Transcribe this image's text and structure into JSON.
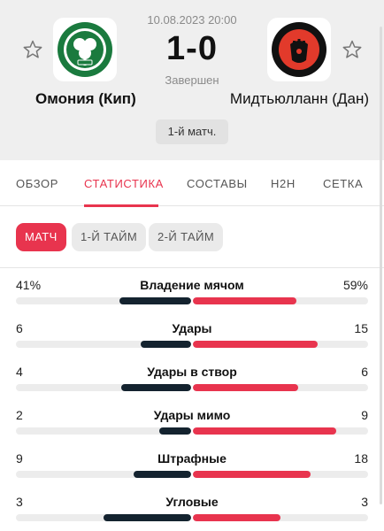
{
  "match": {
    "datetime": "10.08.2023 20:00",
    "score": "1-0",
    "status": "Завершен",
    "leg": "1-й матч.",
    "home": {
      "name": "Омония (Кип)",
      "logo_icon": "omonia-crest-icon",
      "color": "#1a7a3e"
    },
    "away": {
      "name": "Мидтьюлланн (Дан)",
      "logo_icon": "midtjylland-crest-icon",
      "color": "#e23a2b"
    }
  },
  "tabs": [
    {
      "label": "ОБЗОР"
    },
    {
      "label": "СТАТИСТИКА",
      "active": true
    },
    {
      "label": "СОСТАВЫ"
    },
    {
      "label": "H2H"
    },
    {
      "label": "СЕТКА"
    }
  ],
  "periods": [
    {
      "label": "МАТЧ",
      "active": true
    },
    {
      "label": "1-Й ТАЙМ"
    },
    {
      "label": "2-Й ТАЙМ"
    }
  ],
  "colors": {
    "accent": "#e8344e",
    "home_bar": "#14232f",
    "track": "#ececec"
  },
  "stats": [
    {
      "label": "Владение мячом",
      "home": "41%",
      "away": "59%",
      "home_share": 0.41,
      "away_share": 0.59
    },
    {
      "label": "Удары",
      "home": "6",
      "away": "15",
      "home_share": 0.29,
      "away_share": 0.71
    },
    {
      "label": "Удары в створ",
      "home": "4",
      "away": "6",
      "home_share": 0.4,
      "away_share": 0.6
    },
    {
      "label": "Удары мимо",
      "home": "2",
      "away": "9",
      "home_share": 0.18,
      "away_share": 0.82
    },
    {
      "label": "Штрафные",
      "home": "9",
      "away": "18",
      "home_share": 0.33,
      "away_share": 0.67
    },
    {
      "label": "Угловые",
      "home": "3",
      "away": "3",
      "home_share": 0.5,
      "away_share": 0.5
    }
  ]
}
